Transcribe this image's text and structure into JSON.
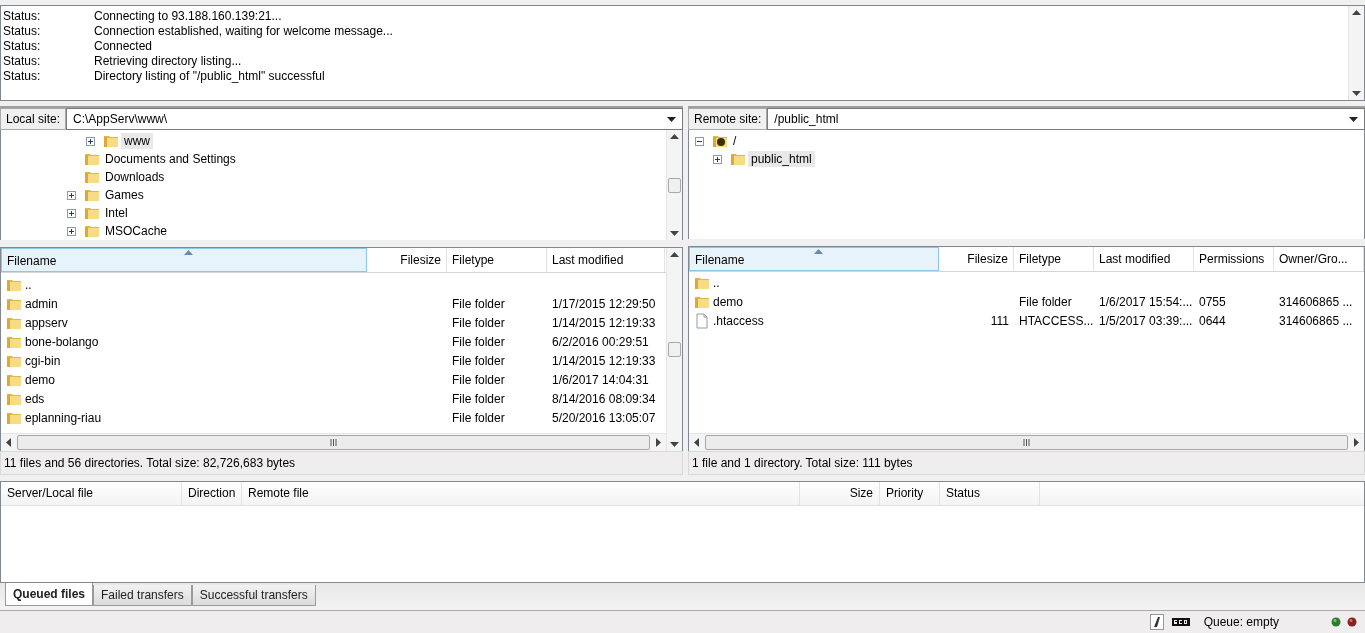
{
  "message_log": [
    {
      "label": "Status:",
      "message": "Connecting to 93.188.160.139:21..."
    },
    {
      "label": "Status:",
      "message": "Connection established, waiting for welcome message..."
    },
    {
      "label": "Status:",
      "message": "Connected"
    },
    {
      "label": "Status:",
      "message": "Retrieving directory listing..."
    },
    {
      "label": "Status:",
      "message": "Directory listing of \"/public_html\" successful"
    }
  ],
  "panes": [
    {
      "site_label": "Local site:",
      "path": "C:\\AppServ\\www\\",
      "tree": [
        {
          "children": [
            {
              "label": "www",
              "kind": "folder",
              "expanded": false,
              "selected": true
            }
          ]
        },
        {
          "label": "Documents and Settings",
          "kind": "folder",
          "selected": false
        },
        {
          "label": "Downloads",
          "kind": "folder",
          "selected": false
        },
        {
          "label": "Games",
          "kind": "folder",
          "expanded": false,
          "selected": false
        },
        {
          "label": "Intel",
          "kind": "folder",
          "expanded": false,
          "selected": false
        },
        {
          "label": "MSOCache",
          "kind": "folder",
          "expanded": false,
          "selected": false
        }
      ],
      "columns": [
        {
          "label": "Filename",
          "sorted": true
        },
        {
          "label": "Filesize",
          "sorted": false
        },
        {
          "label": "Filetype",
          "sorted": false
        },
        {
          "label": "Last modified",
          "sorted": false
        }
      ],
      "rows": [
        {
          "kind": "folder",
          "selected": false,
          "cells": [
            ".."
          ]
        },
        {
          "kind": "folder",
          "selected": false,
          "cells": [
            "admin",
            "",
            "File folder",
            "1/17/2015 12:29:50"
          ]
        },
        {
          "kind": "folder",
          "selected": false,
          "cells": [
            "appserv",
            "",
            "File folder",
            "1/14/2015 12:19:33"
          ]
        },
        {
          "kind": "folder",
          "selected": false,
          "cells": [
            "bone-bolango",
            "",
            "File folder",
            "6/2/2016 00:29:51"
          ]
        },
        {
          "kind": "folder",
          "selected": false,
          "cells": [
            "cgi-bin",
            "",
            "File folder",
            "1/14/2015 12:19:33"
          ]
        },
        {
          "kind": "folder",
          "selected": false,
          "cells": [
            "demo",
            "",
            "File folder",
            "1/6/2017 14:04:31"
          ]
        },
        {
          "kind": "folder",
          "selected": false,
          "cells": [
            "eds",
            "",
            "File folder",
            "8/14/2016 08:09:34"
          ]
        },
        {
          "kind": "folder",
          "selected": false,
          "cells": [
            "eplanning-riau",
            "",
            "File folder",
            "5/20/2016 13:05:07"
          ]
        }
      ],
      "summary": "11 files and 56 directories. Total size: 82,726,683 bytes"
    },
    {
      "site_label": "Remote site:",
      "path": "/public_html",
      "tree": [
        {
          "label": "/",
          "kind": "unknown",
          "expanded": true,
          "selected": false,
          "children": [
            {
              "label": "public_html",
              "kind": "folder",
              "expanded": false,
              "selected": true
            }
          ]
        }
      ],
      "columns": [
        {
          "label": "Filename",
          "sorted": true
        },
        {
          "label": "Filesize",
          "sorted": false
        },
        {
          "label": "Filetype",
          "sorted": false
        },
        {
          "label": "Last modified",
          "sorted": false
        },
        {
          "label": "Permissions",
          "sorted": false
        },
        {
          "label": "Owner/Gro...",
          "sorted": false
        }
      ],
      "rows": [
        {
          "kind": "folder",
          "selected": false,
          "cells": [
            ".."
          ]
        },
        {
          "kind": "folder",
          "selected": false,
          "cells": [
            "demo",
            "",
            "File folder",
            "1/6/2017 15:54:...",
            "0755",
            "314606865 ..."
          ]
        },
        {
          "kind": "file",
          "selected": false,
          "cells": [
            ".htaccess",
            "111",
            "HTACCESS...",
            "1/5/2017 03:39:...",
            "0644",
            "314606865 ..."
          ]
        }
      ],
      "summary": "1 file and 1 directory. Total size: 111 bytes"
    }
  ],
  "queue": {
    "columns": [
      "Server/Local file",
      "Direction",
      "Remote file",
      "Size",
      "Priority",
      "Status"
    ]
  },
  "queue_tabs": [
    {
      "label": "Queued files",
      "selected": true
    },
    {
      "label": "Failed transfers",
      "selected": false
    },
    {
      "label": "Successful transfers",
      "selected": false
    }
  ],
  "status_bar": {
    "queue": "Queue: empty"
  }
}
